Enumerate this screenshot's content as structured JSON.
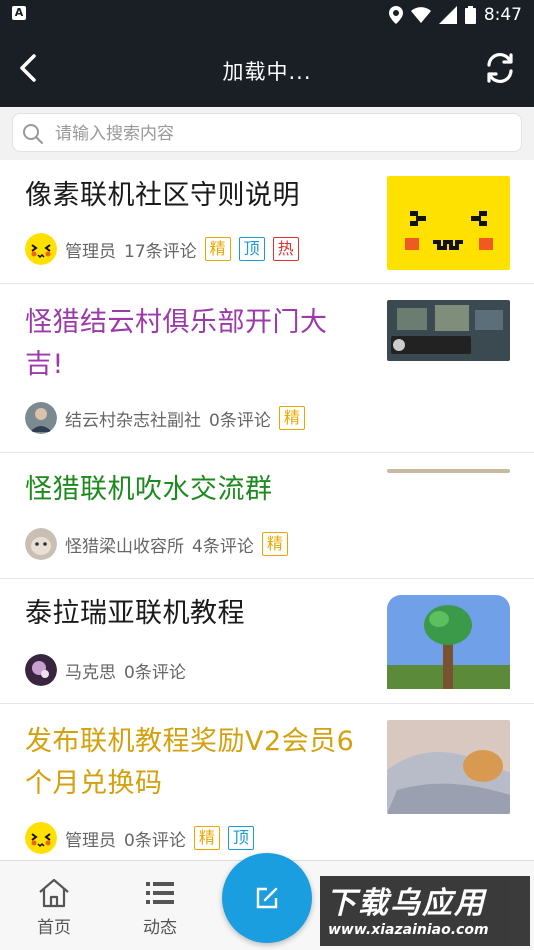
{
  "status_bar": {
    "time": "8:47",
    "a_label": "A"
  },
  "appbar": {
    "title": "加载中..."
  },
  "search": {
    "placeholder": "请输入搜索内容"
  },
  "posts": [
    {
      "title": "像素联机社区守则说明",
      "title_color": "#1a1a1a",
      "author": "管理员",
      "comments": "17条评论",
      "badges": [
        "精",
        "顶",
        "热"
      ]
    },
    {
      "title": "怪猎结云村俱乐部开门大吉!",
      "title_color": "#9b3aa8",
      "author": "结云村杂志社副社",
      "comments": "0条评论",
      "badges": [
        "精"
      ]
    },
    {
      "title": "怪猎联机吹水交流群",
      "title_color": "#1e8a1e",
      "author": "怪猎梁山收容所",
      "comments": "4条评论",
      "badges": [
        "精"
      ]
    },
    {
      "title": "泰拉瑞亚联机教程",
      "title_color": "#1a1a1a",
      "author": "马克思",
      "comments": "0条评论",
      "badges": []
    },
    {
      "title": "发布联机教程奖励V2会员6个月兑换码",
      "title_color": "#d4a10e",
      "author": "管理员",
      "comments": "0条评论",
      "badges": [
        "精",
        "顶"
      ]
    }
  ],
  "bottom_nav": {
    "home": "首页",
    "feed": "动态"
  },
  "watermark": {
    "main": "下载乌应用",
    "url": "www.xiazainiao.com"
  },
  "colors": {
    "appbar_bg": "#1a1f26",
    "fab": "#1a9ee0"
  }
}
